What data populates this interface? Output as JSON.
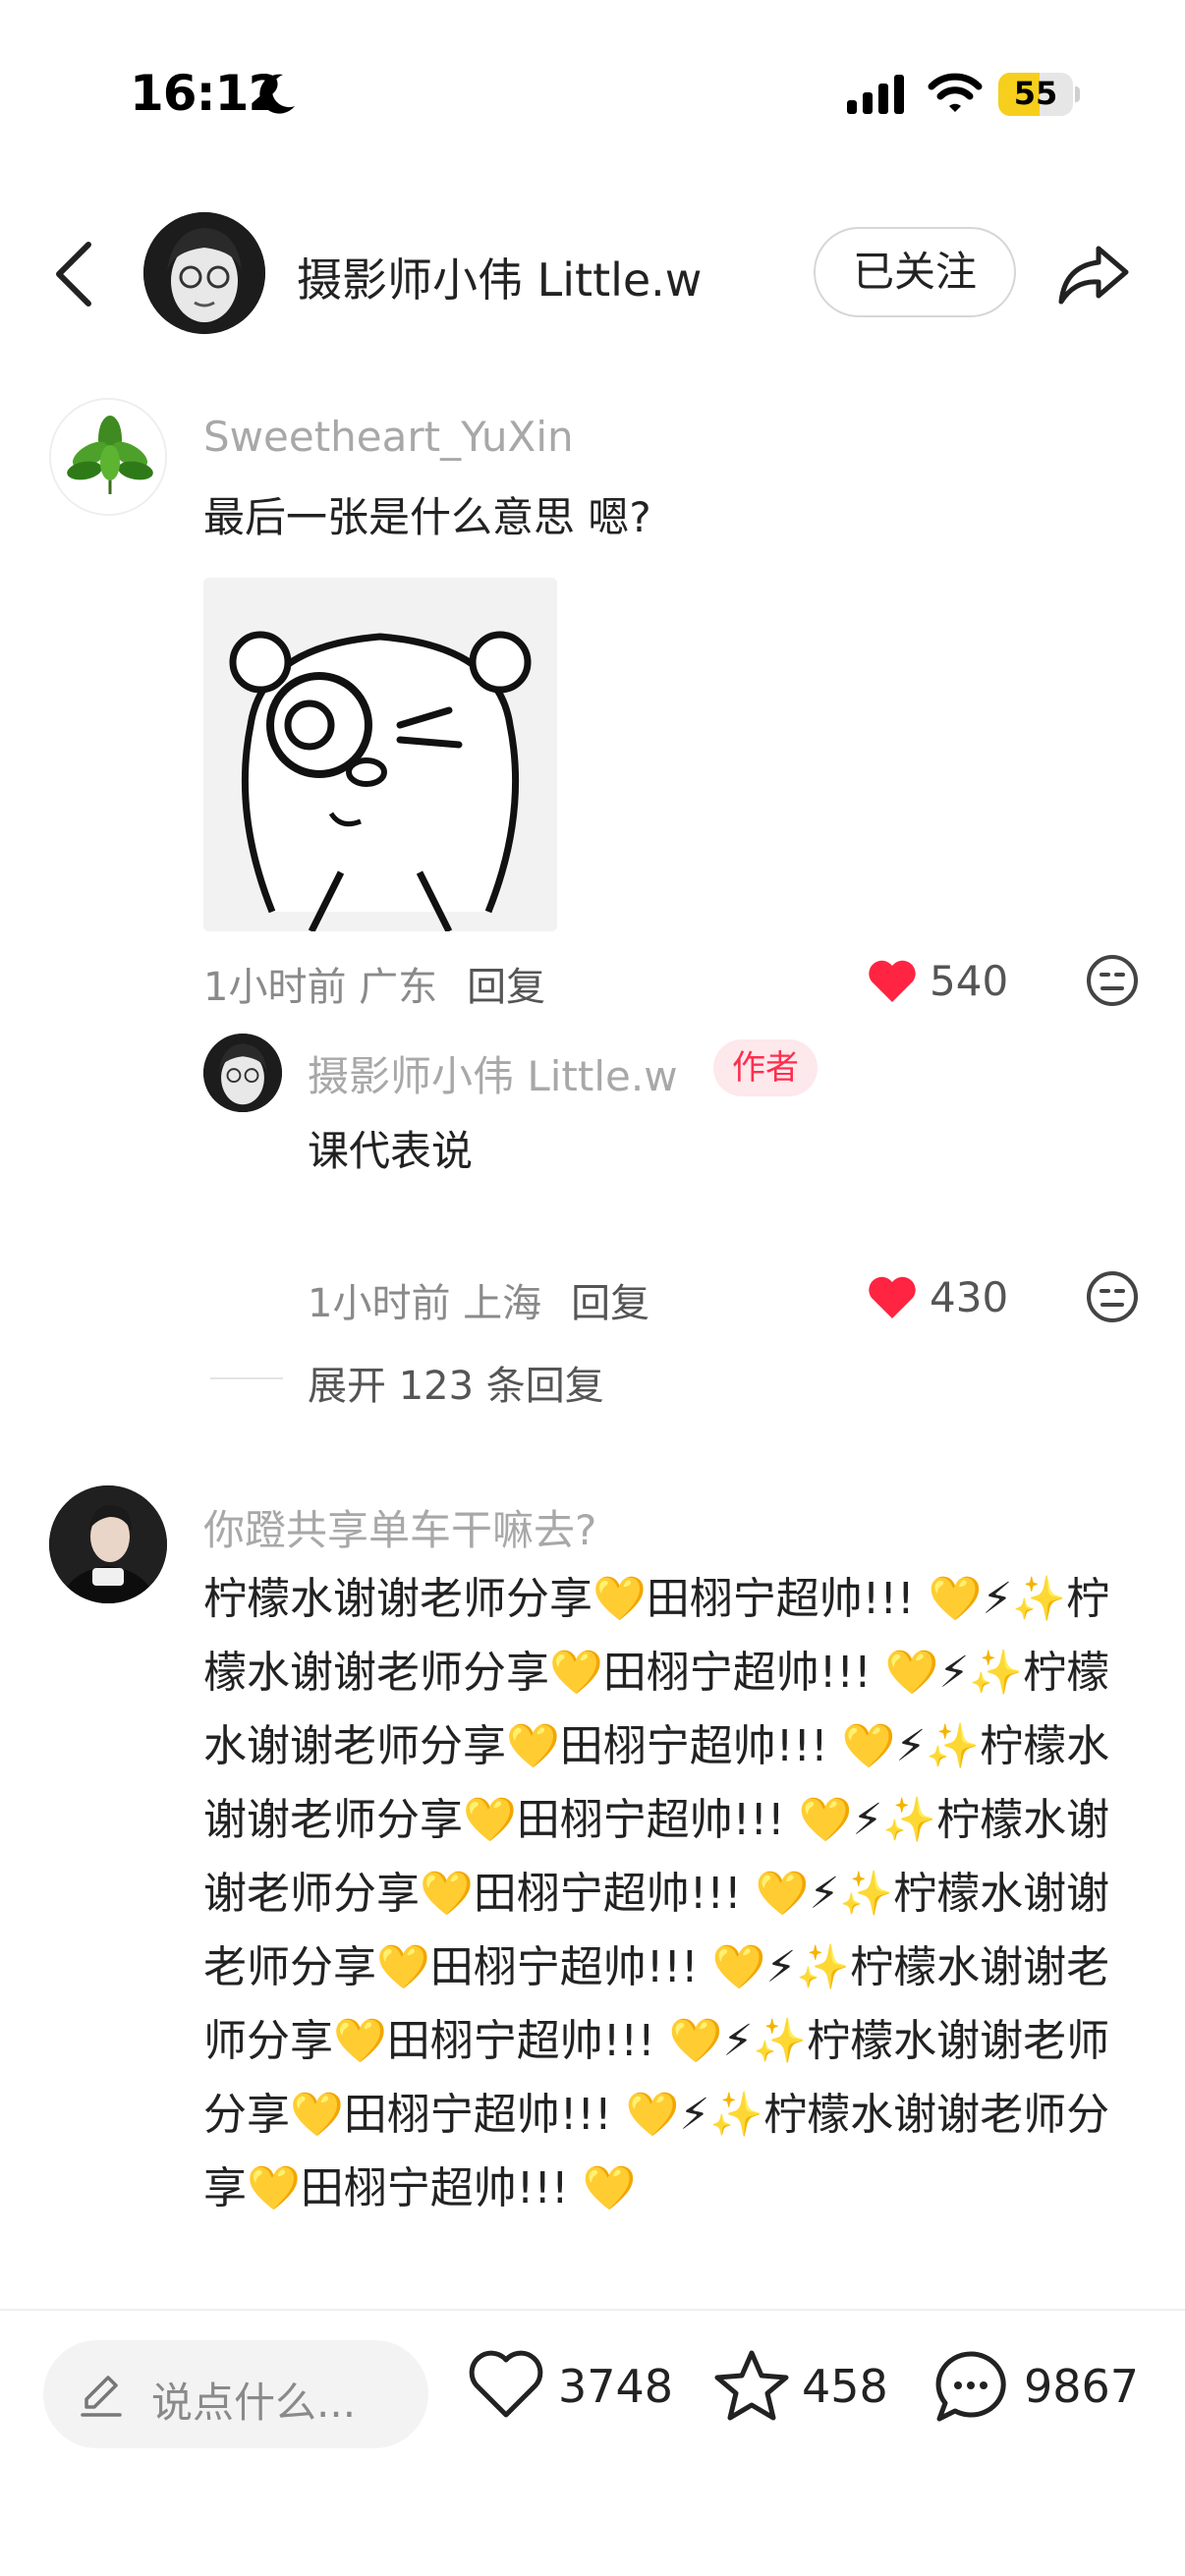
{
  "status_bar": {
    "time": "16:12",
    "battery": "55",
    "battery_level": 0.55
  },
  "header": {
    "author_name": "摄影师小伟 Little.w",
    "follow_label": "已关注"
  },
  "comments": [
    {
      "username": "Sweetheart_YuXin",
      "text": "最后一张是什么意思 嗯?",
      "time_location": "1小时前 广东",
      "reply_label": "回复",
      "likes": "540"
    },
    {
      "username": "你蹬共享单车干嘛去?",
      "text": "柠檬水谢谢老师分享💛田栩宁超帅!!! 💛⚡✨柠檬水谢谢老师分享💛田栩宁超帅!!! 💛⚡✨柠檬水谢谢老师分享💛田栩宁超帅!!! 💛⚡✨柠檬水谢谢老师分享💛田栩宁超帅!!! 💛⚡✨柠檬水谢谢老师分享💛田栩宁超帅!!! 💛⚡✨柠檬水谢谢老师分享💛田栩宁超帅!!! 💛⚡✨柠檬水谢谢老师分享💛田栩宁超帅!!! 💛⚡✨柠檬水谢谢老师分享💛田栩宁超帅!!! 💛⚡✨柠檬水谢谢老师分享💛田栩宁超帅!!! 💛"
    }
  ],
  "reply": {
    "username": "摄影师小伟 Little.w",
    "author_badge": "作者",
    "text": "课代表说",
    "time_location": "1小时前 上海",
    "reply_label": "回复",
    "likes": "430",
    "expand_label": "展开 123 条回复"
  },
  "bottom_bar": {
    "input_placeholder": "说点什么...",
    "likes": "3748",
    "favorites": "458",
    "comments": "9867"
  },
  "colors": {
    "like_red": "#ff2442",
    "author_badge_bg": "#fde8ec",
    "muted_text": "#a8a8a8",
    "battery_yellow": "#f6cf1d"
  },
  "icons": [
    "back-icon",
    "share-icon",
    "heart-icon",
    "emoji-face-icon",
    "pencil-icon",
    "star-icon",
    "comment-bubble-icon",
    "moon-icon",
    "signal-icon",
    "wifi-icon"
  ]
}
